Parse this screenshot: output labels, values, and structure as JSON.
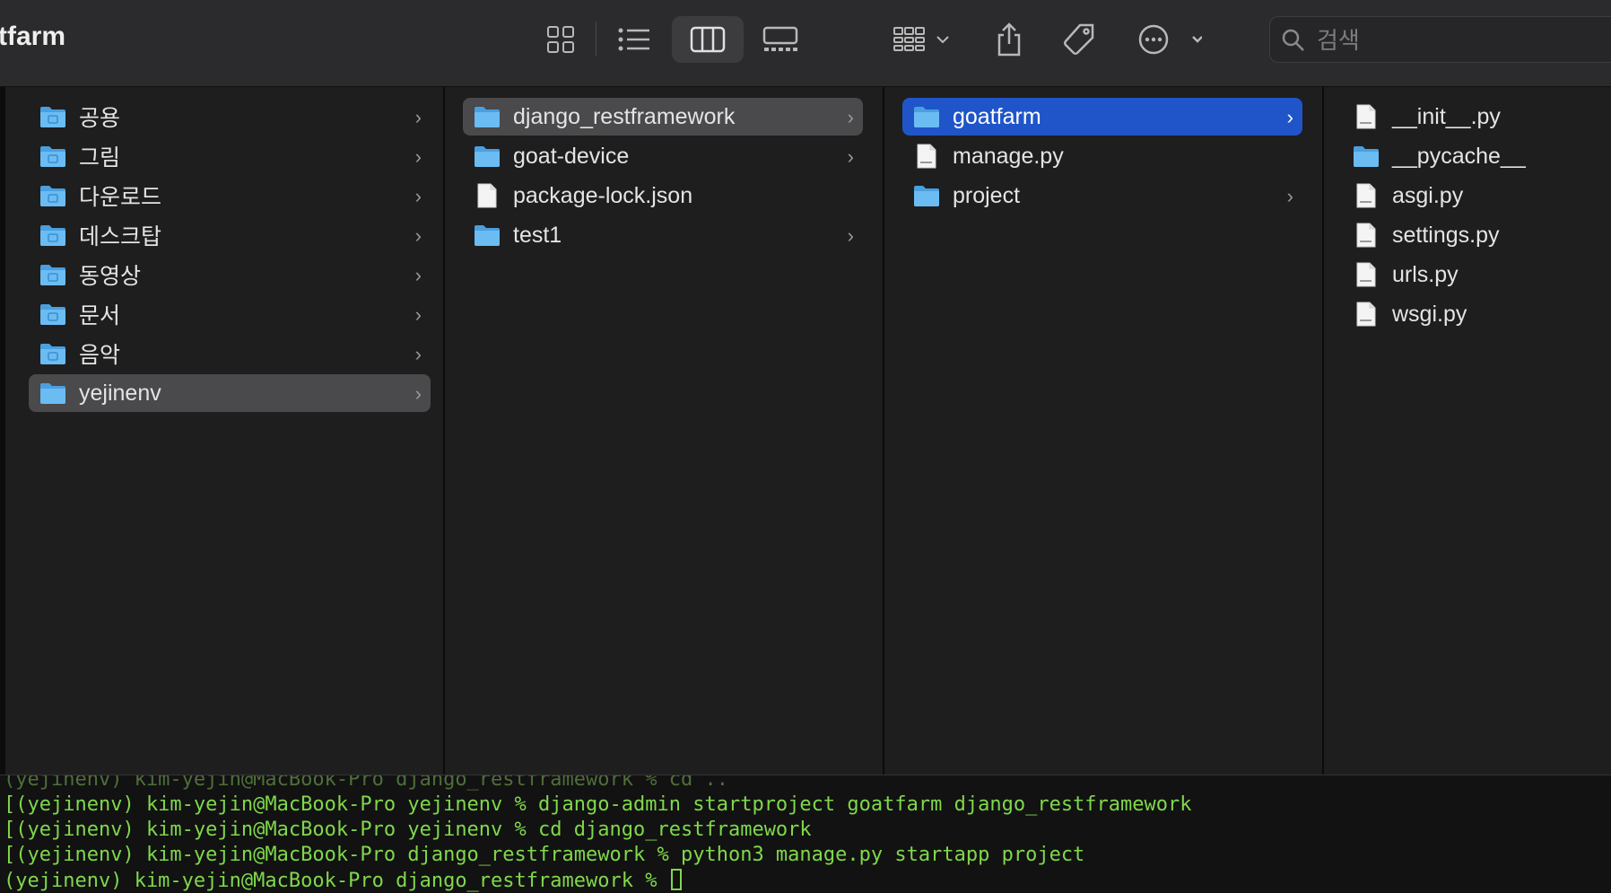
{
  "window": {
    "title": "tfarm"
  },
  "toolbar": {
    "view_icons": [
      "grid-view-icon",
      "list-view-icon",
      "column-view-icon",
      "gallery-view-icon"
    ],
    "active_view": "column-view-icon",
    "group_icon": "group-icon",
    "share_icon": "share-icon",
    "tag_icon": "tag-icon",
    "more_icon": "more-icon",
    "search_placeholder": "검색"
  },
  "columns": [
    {
      "items": [
        {
          "label": "공용",
          "icon": "folder-public-icon",
          "chevron": true,
          "selected": ""
        },
        {
          "label": "그림",
          "icon": "folder-pictures-icon",
          "chevron": true,
          "selected": ""
        },
        {
          "label": "다운로드",
          "icon": "folder-downloads-icon",
          "chevron": true,
          "selected": ""
        },
        {
          "label": "데스크탑",
          "icon": "folder-desktop-icon",
          "chevron": true,
          "selected": ""
        },
        {
          "label": "동영상",
          "icon": "folder-movies-icon",
          "chevron": true,
          "selected": ""
        },
        {
          "label": "문서",
          "icon": "folder-documents-icon",
          "chevron": true,
          "selected": ""
        },
        {
          "label": "음악",
          "icon": "folder-music-icon",
          "chevron": true,
          "selected": ""
        },
        {
          "label": "yejinenv",
          "icon": "folder-icon",
          "chevron": true,
          "selected": "gray"
        }
      ]
    },
    {
      "items": [
        {
          "label": "django_restframework",
          "icon": "folder-icon",
          "chevron": true,
          "selected": "gray"
        },
        {
          "label": "goat-device",
          "icon": "folder-icon",
          "chevron": true,
          "selected": ""
        },
        {
          "label": "package-lock.json",
          "icon": "file-icon",
          "chevron": false,
          "selected": ""
        },
        {
          "label": "test1",
          "icon": "folder-icon",
          "chevron": true,
          "selected": ""
        }
      ]
    },
    {
      "items": [
        {
          "label": "goatfarm",
          "icon": "folder-icon",
          "chevron": true,
          "selected": "blue"
        },
        {
          "label": "manage.py",
          "icon": "python-file-icon",
          "chevron": false,
          "selected": ""
        },
        {
          "label": "project",
          "icon": "folder-icon",
          "chevron": true,
          "selected": ""
        }
      ]
    },
    {
      "items": [
        {
          "label": "__init__.py",
          "icon": "python-file-icon",
          "chevron": false,
          "selected": ""
        },
        {
          "label": "__pycache__",
          "icon": "folder-icon",
          "chevron": false,
          "selected": ""
        },
        {
          "label": "asgi.py",
          "icon": "python-file-icon",
          "chevron": false,
          "selected": ""
        },
        {
          "label": "settings.py",
          "icon": "python-file-icon",
          "chevron": false,
          "selected": ""
        },
        {
          "label": "urls.py",
          "icon": "python-file-icon",
          "chevron": false,
          "selected": ""
        },
        {
          "label": "wsgi.py",
          "icon": "python-file-icon",
          "chevron": false,
          "selected": ""
        }
      ]
    }
  ],
  "terminal": {
    "lines": [
      "(yejinenv) kim-yejin@MacBook-Pro django_restframework % cd ..",
      "[(yejinenv) kim-yejin@MacBook-Pro yejinenv % django-admin startproject goatfarm django_restframework",
      "[(yejinenv) kim-yejin@MacBook-Pro yejinenv % cd django_restframework",
      "[(yejinenv) kim-yejin@MacBook-Pro django_restframework % python3 manage.py startapp project",
      "(yejinenv) kim-yejin@MacBook-Pro django_restframework % "
    ]
  },
  "colors": {
    "selection_blue": "#1f55c9",
    "selection_gray": "#4a494b",
    "folder_blue": "#5fb3ef",
    "terminal_green": "#7fd84b"
  }
}
